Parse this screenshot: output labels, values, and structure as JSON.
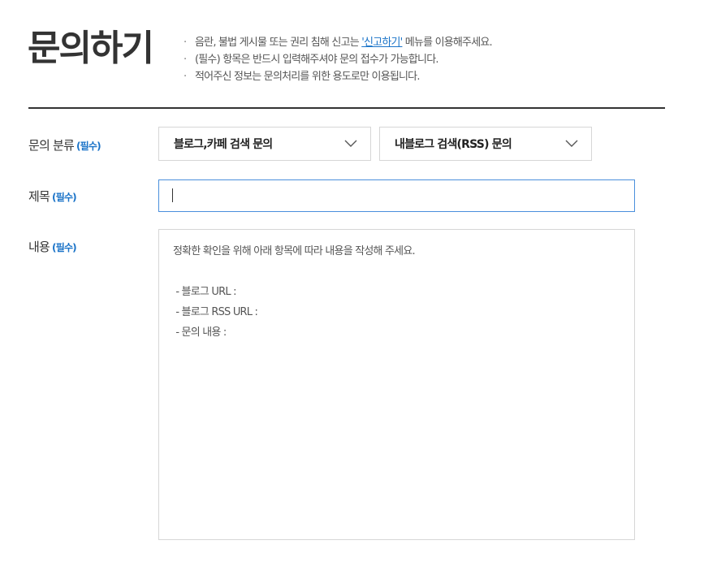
{
  "header": {
    "title": "문의하기",
    "notices": [
      {
        "before": "음란, 불법 게시물 또는 권리 침해 신고는 ",
        "link": "'신고하기'",
        "after": " 메뉴를 이용해주세요."
      },
      {
        "before": "(필수) 항목은 반드시 입력해주셔야 문의 접수가 가능합니다.",
        "link": "",
        "after": ""
      },
      {
        "before": "적어주신 정보는 문의처리를 위한 용도로만 이용됩니다.",
        "link": "",
        "after": ""
      }
    ],
    "bullet": "·"
  },
  "form": {
    "category": {
      "label": "문의 분류",
      "required": "(필수)",
      "select1": "블로그,카페 검색 문의",
      "select2": "내블로그 검색(RSS) 문의"
    },
    "subject": {
      "label": "제목",
      "required": "(필수)",
      "value": ""
    },
    "content": {
      "label": "내용",
      "required": "(필수)",
      "lines": [
        "정확한 확인을 위해 아래 항목에 따라 내용을 작성해 주세요.",
        "",
        " - 블로그 URL :",
        " - 블로그 RSS URL :",
        " - 문의 내용 :"
      ]
    }
  },
  "colors": {
    "accent": "#1a73c8",
    "focus_border": "#4a8fdc",
    "divider": "#333333"
  },
  "icons": {
    "select_arrow": "chevron-down-icon"
  }
}
